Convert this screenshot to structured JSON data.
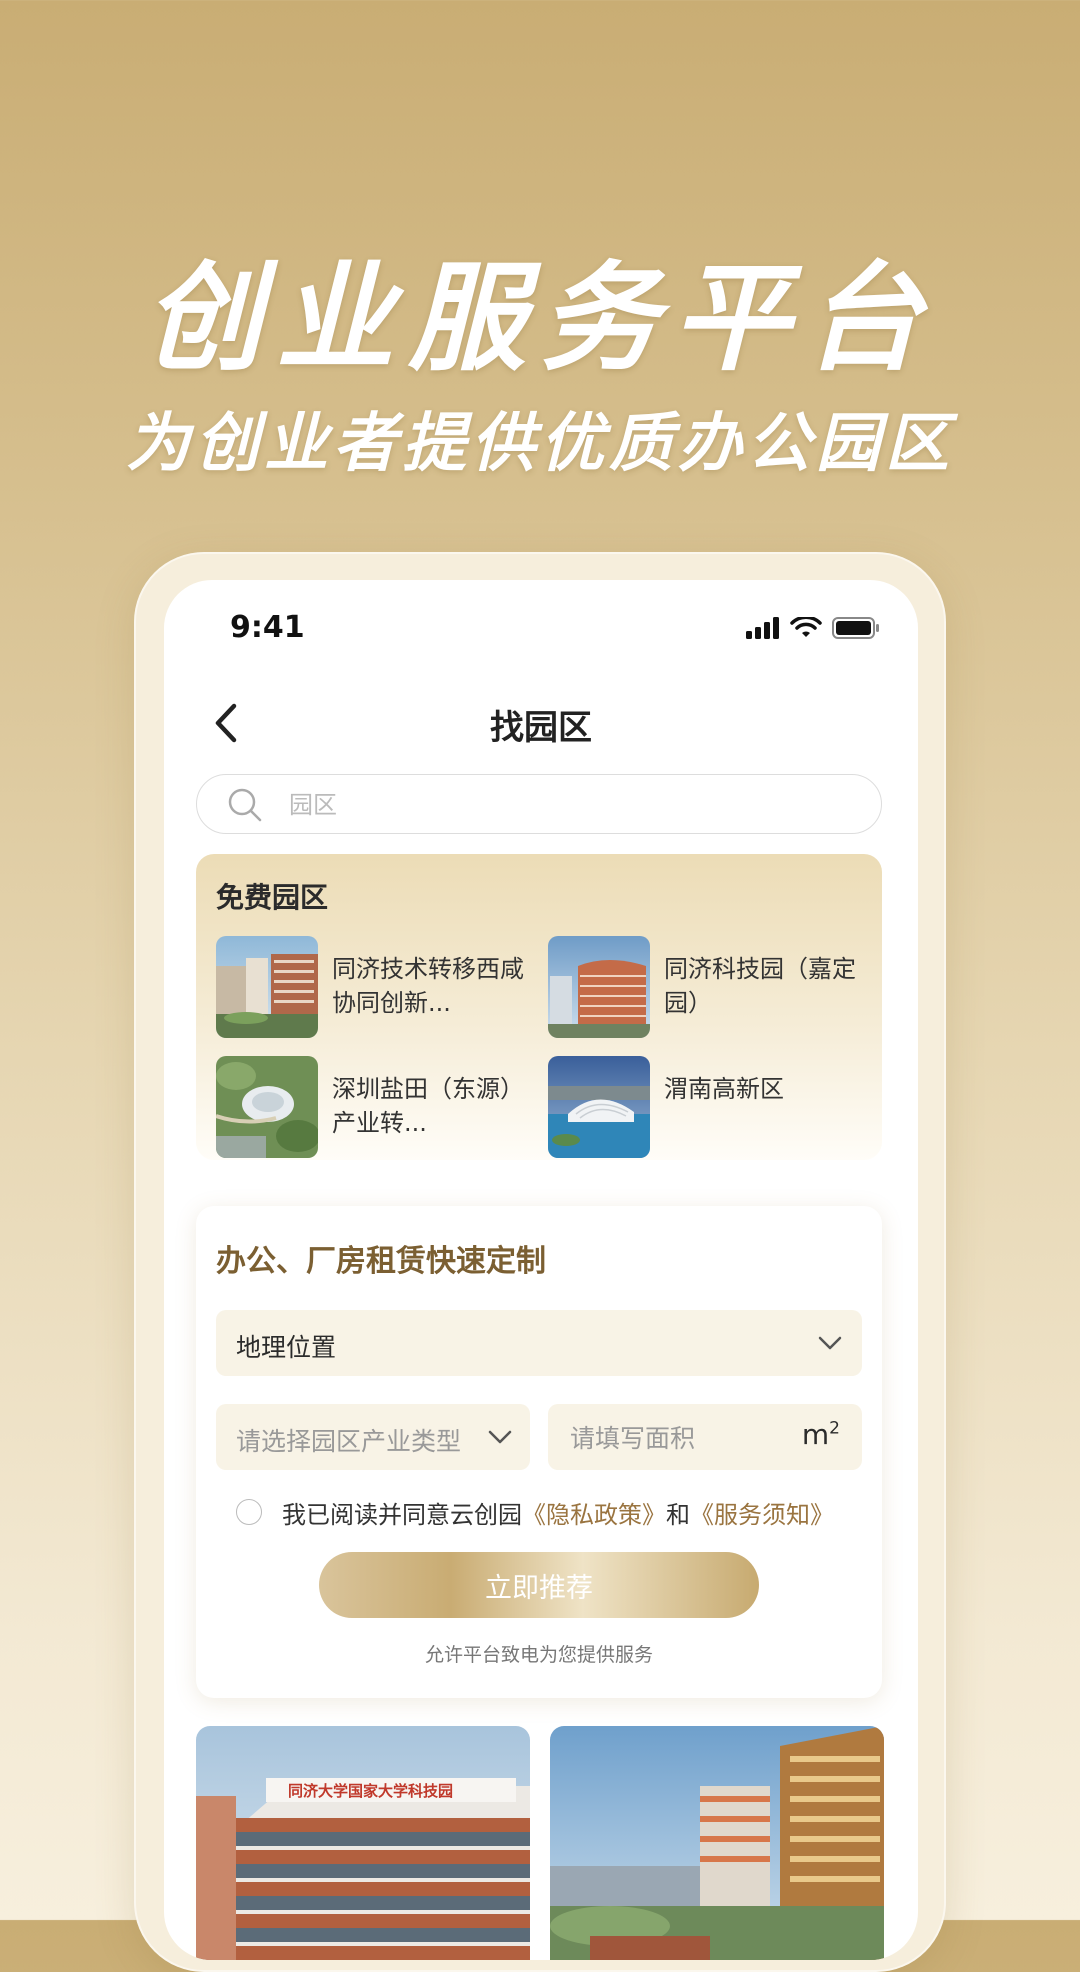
{
  "hero": {
    "title": "创业服务平台",
    "subtitle": "为创业者提供优质办公园区"
  },
  "status_bar": {
    "time": "9:41"
  },
  "nav": {
    "title": "找园区"
  },
  "search": {
    "placeholder": "园区"
  },
  "free_parks": {
    "title": "免费园区",
    "items": [
      {
        "name": "同济技术转移西咸协同创新..."
      },
      {
        "name": "同济科技园（嘉定园）"
      },
      {
        "name": "深圳盐田（东源）产业转..."
      },
      {
        "name": "渭南高新区"
      }
    ]
  },
  "custom": {
    "title": "办公、厂房租赁快速定制",
    "location_label": "地理位置",
    "industry_placeholder": "请选择园区产业类型",
    "area_placeholder": "请填写面积",
    "area_unit": "m",
    "area_unit_sup": "2",
    "agree_prefix": "我已阅读并同意云创园",
    "privacy_link": "《隐私政策》",
    "agree_and": "和",
    "service_link": "《服务须知》",
    "submit_label": "立即推荐",
    "call_note": "允许平台致电为您提供服务"
  },
  "photo_card_sign": "同济大学国家大学科技园",
  "colors": {
    "gold_dark": "#7b5f32",
    "link": "#9a7440",
    "field_bg": "#f8f3e6"
  }
}
